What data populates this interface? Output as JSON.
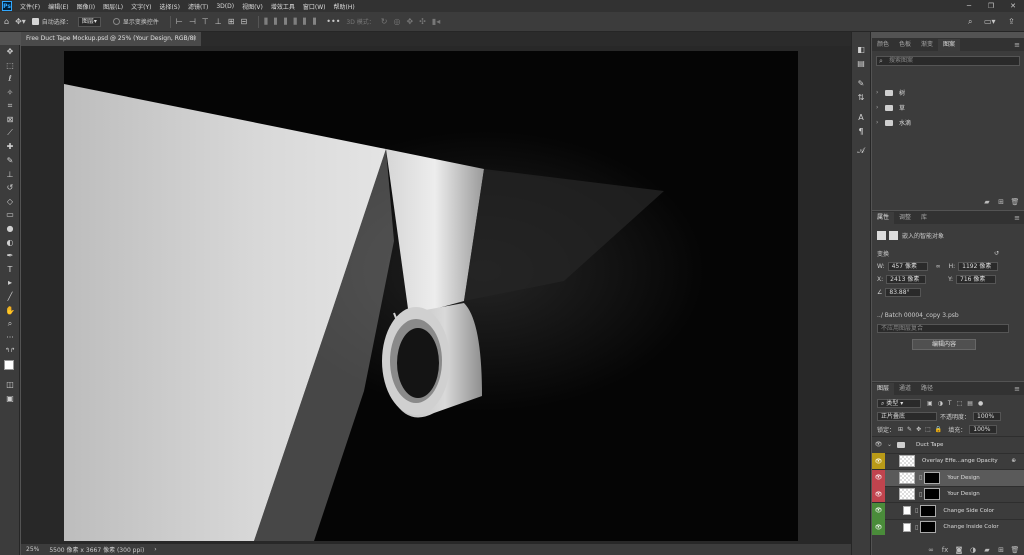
{
  "menubar": {
    "app_logo": "Ps",
    "items": [
      "文件(F)",
      "编辑(E)",
      "图像(I)",
      "图层(L)",
      "文字(Y)",
      "选择(S)",
      "滤镜(T)",
      "3D(D)",
      "视图(V)",
      "增效工具",
      "窗口(W)",
      "帮助(H)"
    ]
  },
  "options": {
    "auto_select_label": "自动选择：",
    "auto_select_value": "图层",
    "show_transform_label": "显示变换控件",
    "more": "•••",
    "mode_3d": "3D 模式："
  },
  "document": {
    "tab_title": "Free Duct Tape Mockup.psd @ 25% (Your Design, RGB/8)",
    "close": "×"
  },
  "status": {
    "zoom": "25%",
    "doc_info": "5500 像素 x 3667 像素 (300 ppi)",
    "arrow": "›"
  },
  "swatches_panel": {
    "tabs": [
      "颜色",
      "色板",
      "渐变",
      "图案"
    ],
    "active_tab": 3,
    "search_placeholder": "搜索图案",
    "groups": [
      "树",
      "草",
      "水滴"
    ]
  },
  "properties_panel": {
    "tabs": [
      "属性",
      "调整",
      "库"
    ],
    "active_tab": 0,
    "object_type": "嵌入的智能对象",
    "transform_label": "变换",
    "w_label": "W:",
    "w_value": "457 像素",
    "h_label": "H:",
    "h_value": "1192 像素",
    "x_label": "X:",
    "x_value": "2413 像素",
    "y_label": "Y:",
    "y_value": "716 像素",
    "angle_value": "83.88°",
    "linked_file": "../ Batch 00004_copy 3.psb",
    "layer_comp_placeholder": "不应用图层复合",
    "edit_button": "编辑内容"
  },
  "layers_panel": {
    "tabs": [
      "图层",
      "通道",
      "路径"
    ],
    "active_tab": 0,
    "filter_kind": "类型",
    "blend_mode": "正片叠底",
    "opacity_label": "不透明度：",
    "opacity_value": "100%",
    "lock_label": "锁定：",
    "fill_label": "填充：",
    "fill_value": "100%",
    "layers": [
      {
        "name": "Duct Tape",
        "type": "group",
        "eye_color": "none",
        "selected": false
      },
      {
        "name": "Overlay Effe...ange Opacity",
        "type": "smart",
        "eye_color": "yellow",
        "selected": false
      },
      {
        "name": "Your Design",
        "type": "smart-masked",
        "eye_color": "red",
        "selected": true
      },
      {
        "name": "Your Design",
        "type": "smart-masked",
        "eye_color": "red",
        "selected": false
      },
      {
        "name": "Change Side Color",
        "type": "fill-masked",
        "eye_color": "green",
        "selected": false
      },
      {
        "name": "Change Inside Color",
        "type": "fill-masked",
        "eye_color": "green",
        "selected": false
      }
    ],
    "footer_icons": [
      "link-icon",
      "fx-icon",
      "mask-icon",
      "adjustment-icon",
      "group-icon",
      "new-layer-icon",
      "trash-icon"
    ]
  }
}
